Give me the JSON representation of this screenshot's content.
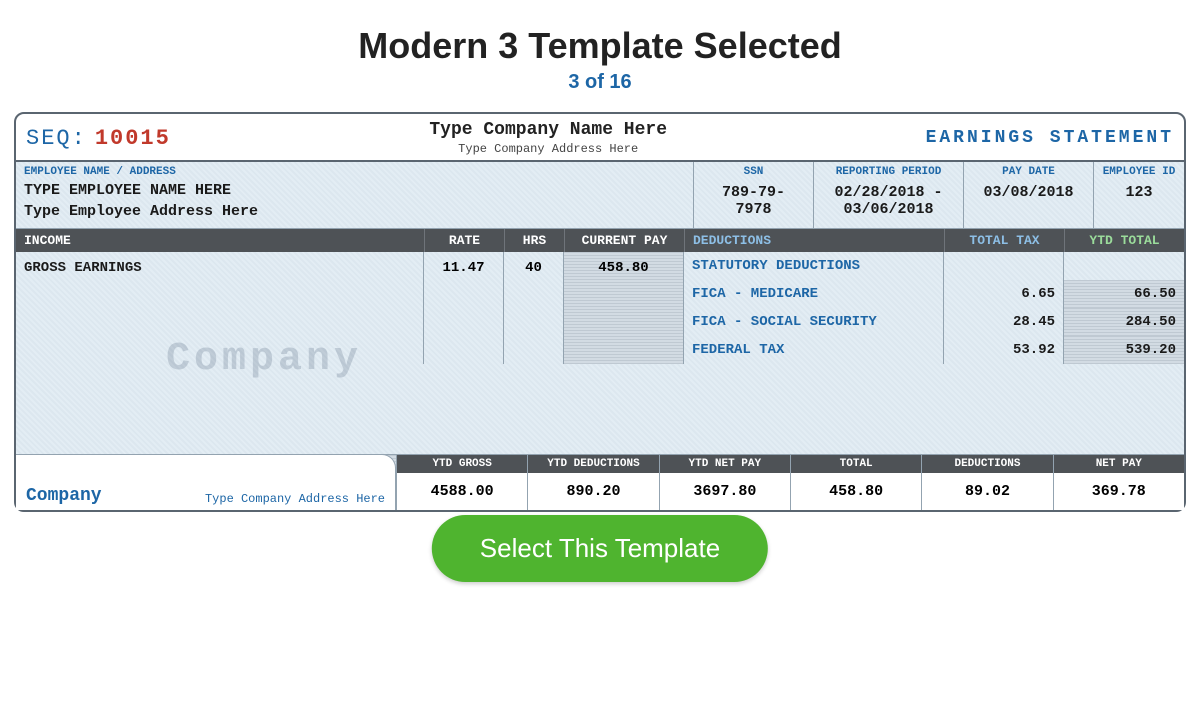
{
  "title": "Modern 3 Template Selected",
  "subtitle": "3 of 16",
  "seq": {
    "label": "SEQ:",
    "value": "10015"
  },
  "header": {
    "company_name": "Type Company Name Here",
    "company_address": "Type Company Address Here",
    "statement_label": "EARNINGS STATEMENT"
  },
  "employee": {
    "heading": "EMPLOYEE NAME / ADDRESS",
    "name": "TYPE EMPLOYEE NAME HERE",
    "address": "Type Employee Address Here",
    "ssn": {
      "label": "SSN",
      "value": "789-79-7978"
    },
    "period": {
      "label": "REPORTING PERIOD",
      "value": "02/28/2018 - 03/06/2018"
    },
    "pay_date": {
      "label": "PAY DATE",
      "value": "03/08/2018"
    },
    "emp_id": {
      "label": "EMPLOYEE ID",
      "value": "123"
    }
  },
  "columns": {
    "income": "INCOME",
    "rate": "RATE",
    "hrs": "HRS",
    "current": "CURRENT PAY",
    "deductions": "DEDUCTIONS",
    "total_tax": "TOTAL TAX",
    "ytd_total": "YTD TOTAL"
  },
  "income": {
    "label": "GROSS EARNINGS",
    "rate": "11.47",
    "hrs": "40",
    "current": "458.80"
  },
  "deductions": {
    "sub_header": "STATUTORY DEDUCTIONS",
    "lines": [
      {
        "name": "FICA - MEDICARE",
        "tax": "6.65",
        "ytd": "66.50"
      },
      {
        "name": "FICA - SOCIAL SECURITY",
        "tax": "28.45",
        "ytd": "284.50"
      },
      {
        "name": "FEDERAL TAX",
        "tax": "53.92",
        "ytd": "539.20"
      }
    ]
  },
  "watermark": "Company",
  "footer_company": {
    "title": "Company",
    "address": "Type Company Address Here"
  },
  "totals": {
    "ytd_gross": {
      "label": "YTD GROSS",
      "value": "4588.00"
    },
    "ytd_deductions": {
      "label": "YTD DEDUCTIONS",
      "value": "890.20"
    },
    "ytd_net": {
      "label": "YTD NET PAY",
      "value": "3697.80"
    },
    "total": {
      "label": "TOTAL",
      "value": "458.80"
    },
    "deductions": {
      "label": "DEDUCTIONS",
      "value": "89.02"
    },
    "net_pay": {
      "label": "NET PAY",
      "value": "369.78"
    }
  },
  "select_button": "Select This Template"
}
